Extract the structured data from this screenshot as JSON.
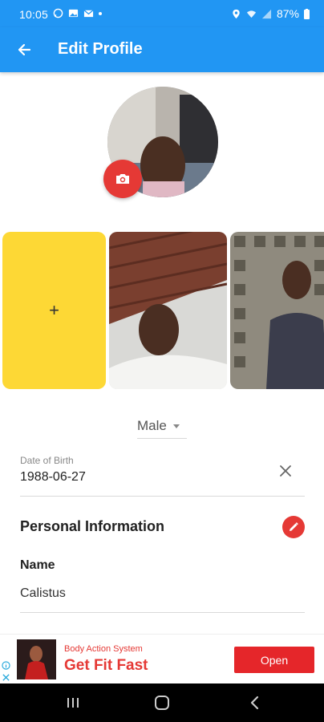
{
  "status_bar": {
    "time": "10:05",
    "battery": "87%"
  },
  "app_bar": {
    "title": "Edit Profile"
  },
  "gallery": {
    "add_symbol": "+"
  },
  "gender": {
    "value": "Male"
  },
  "dob": {
    "label": "Date of Birth",
    "value": "1988-06-27"
  },
  "personal_info": {
    "title": "Personal Information",
    "name_label": "Name",
    "name_value": "Calistus"
  },
  "ad": {
    "subtitle": "Body Action System",
    "headline": "Get Fit Fast",
    "button_label": "Open"
  },
  "colors": {
    "primary": "#2196f3",
    "accent_red": "#e53935",
    "add_tile_yellow": "#fdd835"
  },
  "icons": [
    "whatsapp-icon",
    "gallery-icon",
    "mail-icon",
    "location-icon",
    "wifi-icon",
    "signal-icon",
    "battery-icon",
    "back-arrow-icon",
    "camera-icon",
    "plus-icon",
    "chevron-down-icon",
    "close-icon",
    "pencil-icon",
    "ad-info-icon",
    "ad-close-icon",
    "recents-icon",
    "home-icon",
    "back-icon"
  ]
}
